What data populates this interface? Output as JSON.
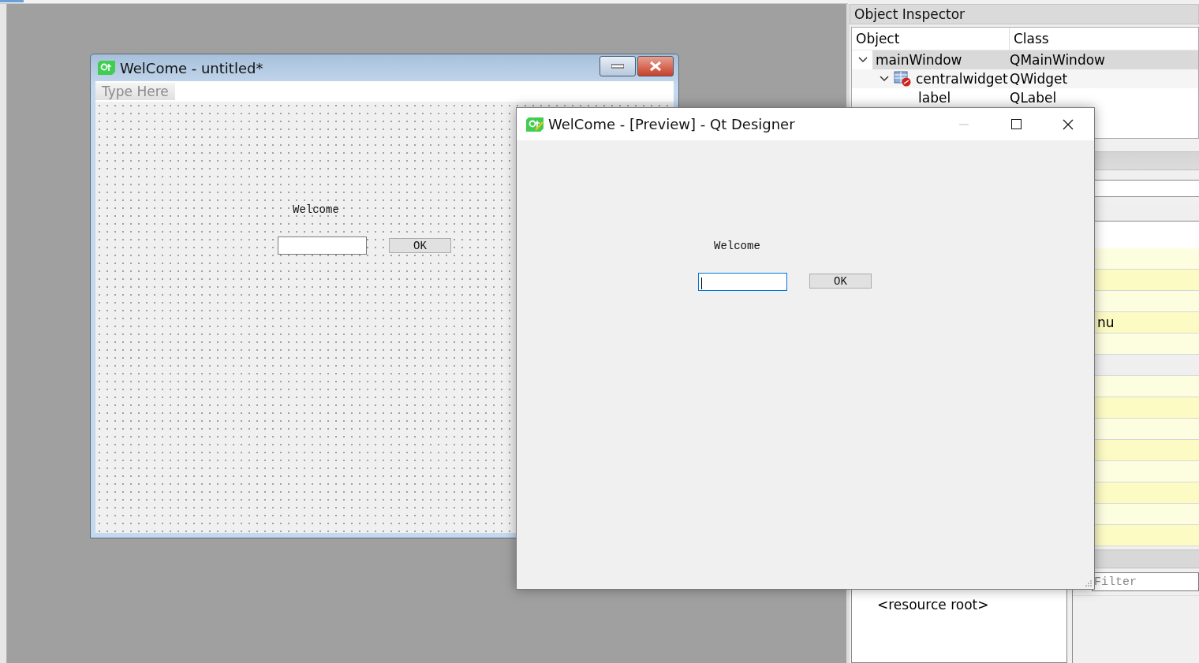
{
  "design_window": {
    "title": "WelCome - untitled*",
    "menu_placeholder": "Type Here",
    "label": "Welcome",
    "button": "OK"
  },
  "preview_window": {
    "title": "WelCome - [Preview] - Qt Designer",
    "label": "Welcome",
    "button": "OK",
    "input_focused": true
  },
  "object_inspector": {
    "title": "Object Inspector",
    "columns": [
      "Object",
      "Class"
    ],
    "rows": [
      {
        "name": "mainWindow",
        "class": "QMainWindow",
        "selected": true,
        "expanded": true,
        "children": [
          {
            "name": "centralwidget",
            "class": "QWidget",
            "selected": false,
            "expanded": true,
            "children": [
              {
                "name": "label",
                "class": "QLabel",
                "selected": false
              }
            ]
          }
        ]
      }
    ]
  },
  "property_editor": {
    "visible_text": "nu"
  },
  "resource_browser": {
    "filter_placeholder": "Filter",
    "root": "<resource root>"
  }
}
